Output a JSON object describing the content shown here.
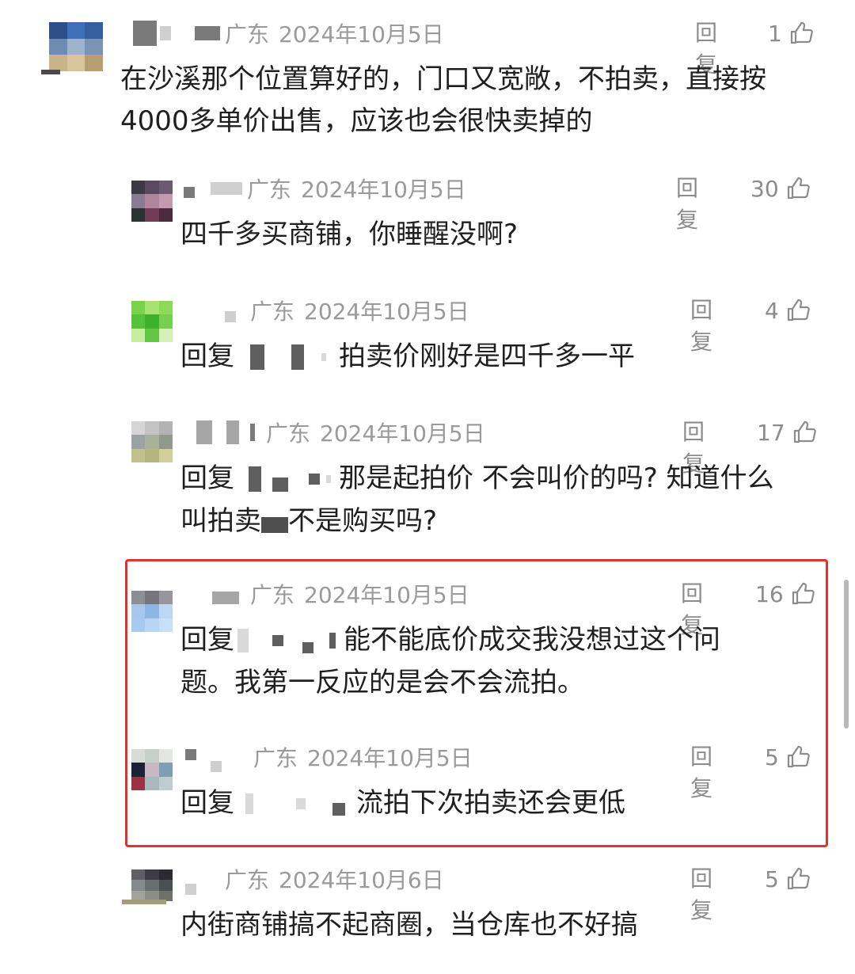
{
  "ui": {
    "reply_label": "回复",
    "colors": {
      "highlight_border": "#e0322f",
      "meta_text": "#9a9a9a",
      "body_text": "#1f1f1f"
    }
  },
  "comments": [
    {
      "location": "广东",
      "date": "2024年10月5日",
      "likes": "1",
      "text": "在沙溪那个位置算好的，门口又宽敞，不拍卖，直接按4000多单价出售，应该也会很快卖掉的"
    },
    {
      "location": "广东",
      "date": "2024年10月5日",
      "likes": "30",
      "text": "四千多买商铺，你睡醒没啊?"
    },
    {
      "location": "广东",
      "date": "2024年10月5日",
      "likes": "4",
      "reply_prefix": "回复",
      "text": "拍卖价刚好是四千多一平"
    },
    {
      "location": "广东",
      "date": "2024年10月5日",
      "likes": "17",
      "reply_prefix": "回复",
      "text_line1": "那是起拍价 不会叫价的吗? 知道什么",
      "text_line2": "叫拍卖",
      "text_line2b": "不是购买吗?"
    },
    {
      "location": "广东",
      "date": "2024年10月5日",
      "likes": "16",
      "reply_prefix": "回复",
      "text_line1": "能不能底价成交我没想过这个问",
      "text_line2": "题。我第一反应的是会不会流拍。"
    },
    {
      "location": "广东",
      "date": "2024年10月5日",
      "likes": "5",
      "reply_prefix": "回复",
      "text": "流拍下次拍卖还会更低"
    },
    {
      "location": "广东",
      "date": "2024年10月6日",
      "likes": "5",
      "text": "内街商铺搞不起商圈，当仓库也不好搞"
    }
  ]
}
